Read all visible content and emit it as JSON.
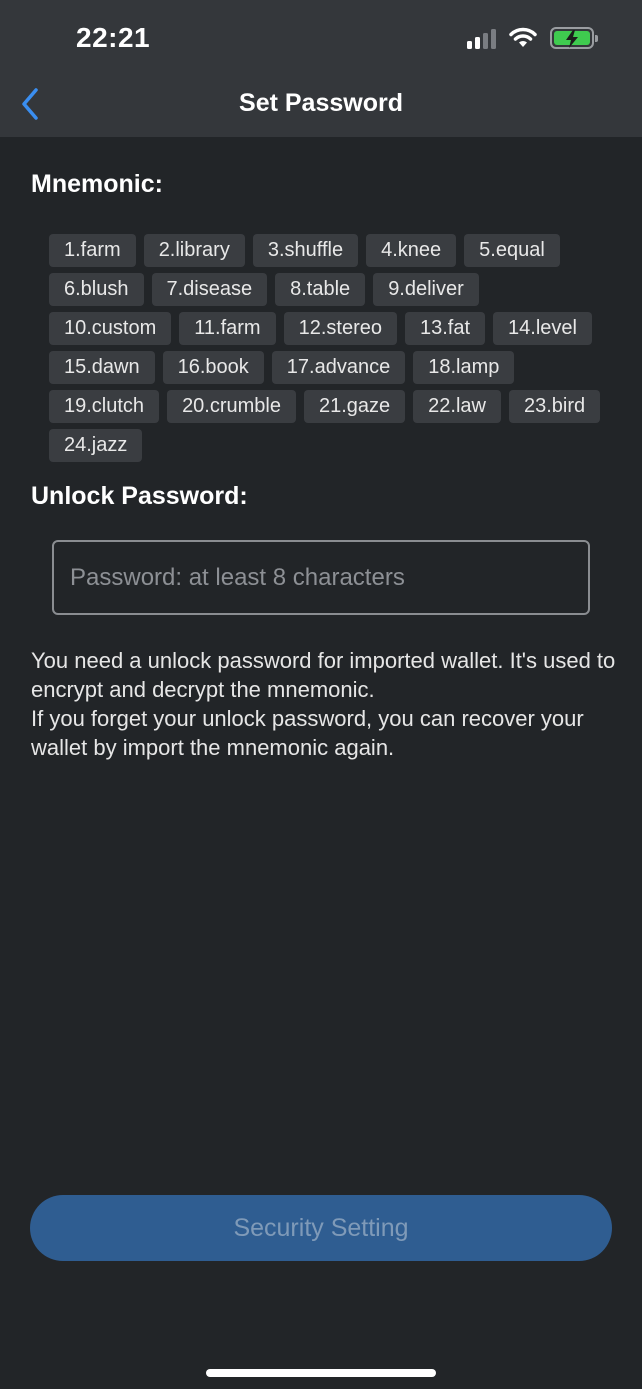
{
  "status_bar": {
    "time": "22:21"
  },
  "nav": {
    "title": "Set Password"
  },
  "mnemonic": {
    "label": "Mnemonic:",
    "words": [
      "1.farm",
      "2.library",
      "3.shuffle",
      "4.knee",
      "5.equal",
      "6.blush",
      "7.disease",
      "8.table",
      "9.deliver",
      "10.custom",
      "11.farm",
      "12.stereo",
      "13.fat",
      "14.level",
      "15.dawn",
      "16.book",
      "17.advance",
      "18.lamp",
      "19.clutch",
      "20.crumble",
      "21.gaze",
      "22.law",
      "23.bird",
      "24.jazz"
    ]
  },
  "password": {
    "label": "Unlock Password:",
    "placeholder": "Password: at least 8 characters",
    "value": ""
  },
  "hint": {
    "line1": "You need a unlock password for imported wallet. It's used to encrypt and decrypt the mnemonic.",
    "line2": "If you forget your unlock password, you can recover your wallet by import the mnemonic again."
  },
  "actions": {
    "primary_label": "Security Setting"
  },
  "icons": {
    "back": "chevron-left-icon",
    "signal": "cellular-signal-icon",
    "wifi": "wifi-icon",
    "battery": "battery-charging-icon"
  },
  "colors": {
    "accent": "#2f5d91",
    "back_arrow": "#3a8ef0",
    "background": "#222528",
    "header": "#34373b",
    "chip": "#3a3d41"
  }
}
